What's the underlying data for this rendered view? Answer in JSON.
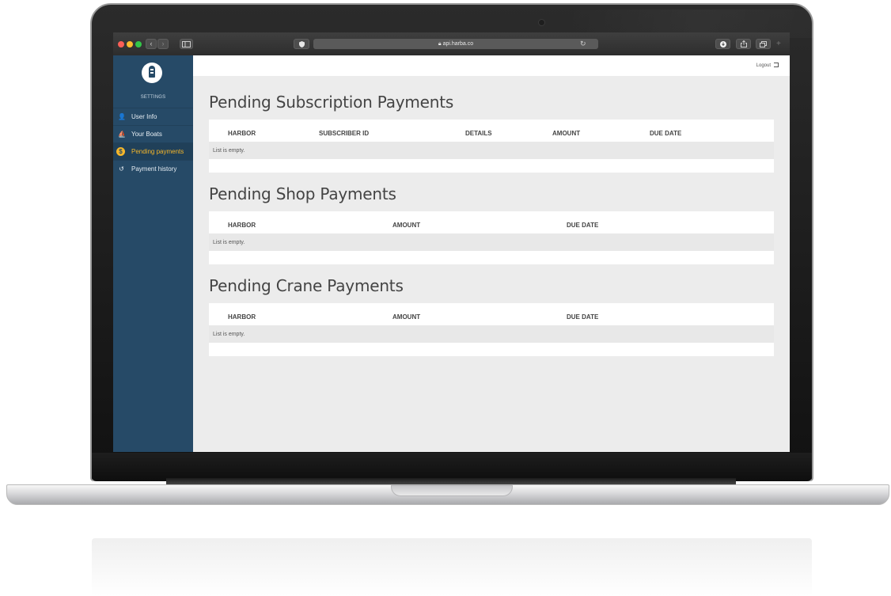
{
  "browser": {
    "url": "api.harba.co",
    "nav_back_glyph": "‹",
    "nav_forward_glyph": "›",
    "reload_glyph": "↻",
    "new_tab_glyph": "+"
  },
  "sidebar": {
    "section_label": "SETTINGS",
    "items": [
      {
        "label": "User Info",
        "icon": "user-icon",
        "glyph": "👤"
      },
      {
        "label": "Your Boats",
        "icon": "boat-icon",
        "glyph": "⛵"
      },
      {
        "label": "Pending payments",
        "icon": "dollar-icon",
        "glyph": "$",
        "active": true
      },
      {
        "label": "Payment history",
        "icon": "history-icon",
        "glyph": "↺"
      }
    ]
  },
  "header": {
    "logout_label": "Logout"
  },
  "sections": [
    {
      "title": "Pending Subscription Payments",
      "columns": [
        "HARBOR",
        "SUBSCRIBER ID",
        "DETAILS",
        "AMOUNT",
        "DUE DATE"
      ],
      "empty_text": "List is empty."
    },
    {
      "title": "Pending Shop Payments",
      "columns": [
        "HARBOR",
        "AMOUNT",
        "DUE DATE"
      ],
      "empty_text": "List is empty."
    },
    {
      "title": "Pending Crane Payments",
      "columns": [
        "HARBOR",
        "AMOUNT",
        "DUE DATE"
      ],
      "empty_text": "List is empty."
    }
  ],
  "colors": {
    "sidebar_bg": "#264a67",
    "active_accent": "#f5b62a",
    "content_bg": "#ececec"
  }
}
